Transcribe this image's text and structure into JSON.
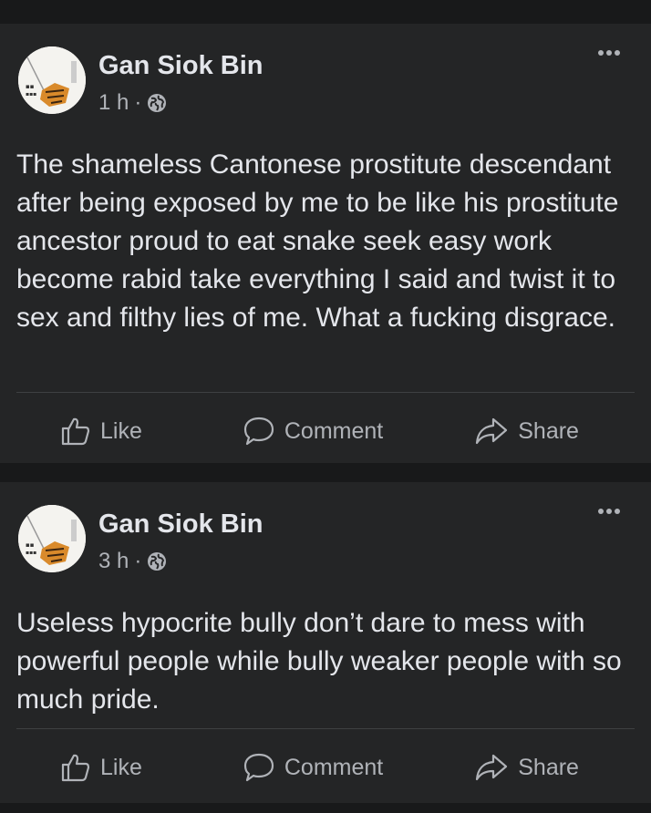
{
  "posts": [
    {
      "author": "Gan Siok Bin",
      "time": "1 h",
      "separator": "·",
      "privacy_icon": "globe-icon",
      "text": "The shameless Cantonese prostitute descendant after being exposed by me to be like his prostitute ancestor proud to eat snake seek easy work become rabid take everything I said and twist it to sex and filthy lies of me. What a fucking disgrace.",
      "actions": {
        "like": "Like",
        "comment": "Comment",
        "share": "Share"
      }
    },
    {
      "author": "Gan Siok Bin",
      "time": "3 h",
      "separator": "·",
      "privacy_icon": "globe-icon",
      "text": "Useless hypocrite bully don’t dare to mess with powerful people while bully weaker people with so much pride.",
      "actions": {
        "like": "Like",
        "comment": "Comment",
        "share": "Share"
      }
    }
  ],
  "colors": {
    "background": "#18191a",
    "card": "#242526",
    "primary_text": "#e4e6eb",
    "secondary_text": "#b0b3b8",
    "divider": "#3e4042"
  }
}
